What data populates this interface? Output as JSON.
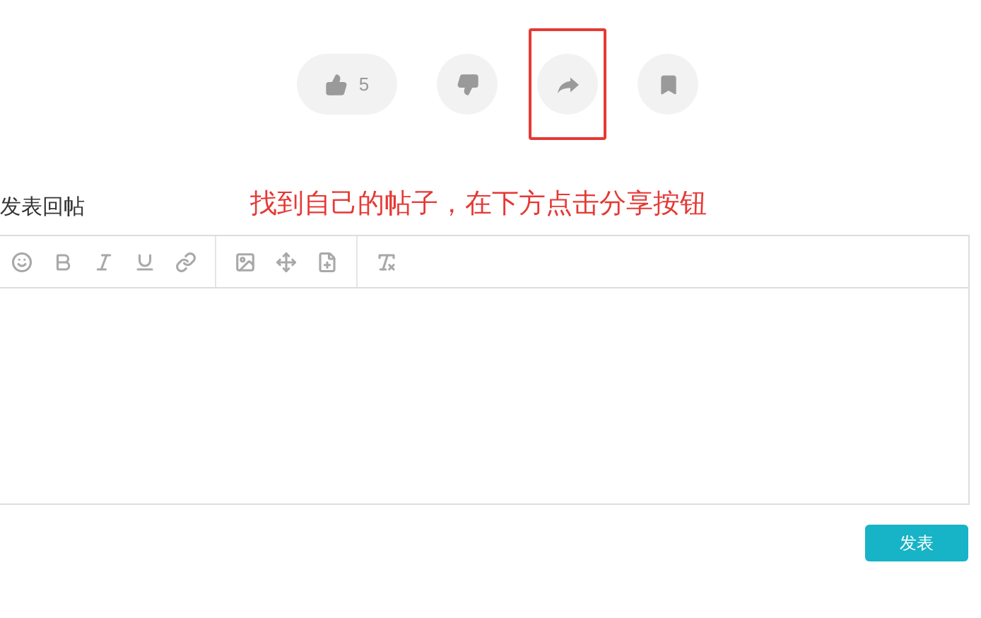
{
  "actions": [
    {
      "kind": "like",
      "count": "5",
      "highlighted": false
    },
    {
      "kind": "dislike",
      "highlighted": false
    },
    {
      "kind": "share",
      "highlighted": true
    },
    {
      "kind": "bookmark",
      "highlighted": false
    }
  ],
  "reply": {
    "title": "发表回帖",
    "annotation": "找到自己的帖子，在下方点击分享按钮",
    "submit": "发表"
  }
}
